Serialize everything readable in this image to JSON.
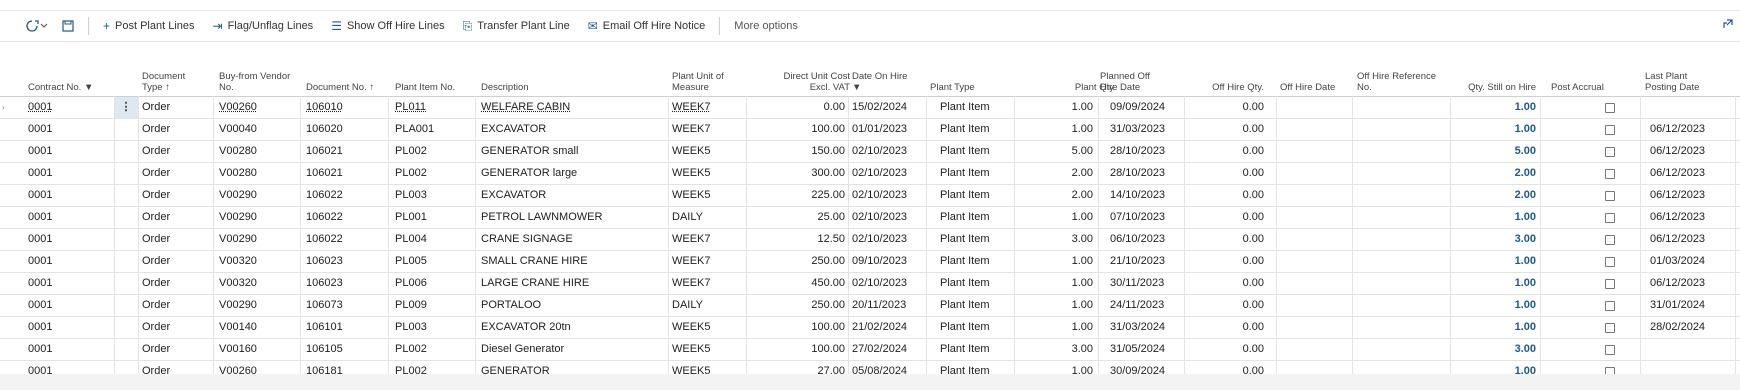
{
  "toolbar": {
    "icon_left_1": "refresh-options-icon",
    "icon_left_2": "save-icon",
    "buttons": [
      {
        "name": "post-plant-lines-button",
        "icon": "plus-icon",
        "glyph": "+",
        "label": "Post Plant Lines"
      },
      {
        "name": "flag-unflag-lines-button",
        "icon": "flag-icon",
        "glyph": "⇥",
        "label": "Flag/Unflag Lines"
      },
      {
        "name": "show-off-hire-lines-button",
        "icon": "list-icon",
        "glyph": "☰",
        "label": "Show Off Hire Lines"
      },
      {
        "name": "transfer-plant-line-button",
        "icon": "transfer-icon",
        "glyph": "⎘",
        "label": "Transfer Plant Line"
      },
      {
        "name": "email-off-hire-notice-button",
        "icon": "email-icon",
        "glyph": "✉",
        "label": "Email Off Hire Notice"
      }
    ],
    "more_options": "More options"
  },
  "headers": {
    "contract_no": "Contract No.",
    "document_type_1": "Document",
    "document_type_2": "Type ↑",
    "vendor_no_1": "Buy-from Vendor",
    "vendor_no_2": "No.",
    "document_no": "Document No. ↑",
    "plant_item_no": "Plant Item No.",
    "description": "Description",
    "uom_1": "Plant Unit of",
    "uom_2": "Measure",
    "unit_cost_1": "Direct Unit Cost",
    "unit_cost_2": "Excl. VAT",
    "date_on_hire": "Date On Hire",
    "plant_type": "Plant Type",
    "plant_qty": "Plant Qty",
    "planned_off_1": "Planned Off",
    "planned_off_2": "Hire Date",
    "off_hire_qty": "Off Hire Qty.",
    "off_hire_date": "Off Hire Date",
    "off_hire_ref_1": "Off Hire Reference",
    "off_hire_ref_2": "No.",
    "qty_still_on_hire": "Qty. Still on Hire",
    "post_accrual": "Post Accrual",
    "last_posting_1": "Last Plant",
    "last_posting_2": "Posting Date"
  },
  "rows": [
    {
      "contract": "0001",
      "type": "Order",
      "vendor": "V00260",
      "doc": "106010",
      "item": "PL011",
      "desc": "WELFARE CABIN",
      "uom": "WEEK7",
      "cost": "0.00",
      "on_hire": "15/02/2024",
      "ptype": "Plant Item",
      "qty": "1.00",
      "planned_off": "09/09/2024",
      "off_qty": "0.00",
      "still": "1.00",
      "last_post": ""
    },
    {
      "contract": "0001",
      "type": "Order",
      "vendor": "V00040",
      "doc": "106020",
      "item": "PLA001",
      "desc": "EXCAVATOR",
      "uom": "WEEK7",
      "cost": "100.00",
      "on_hire": "01/01/2023",
      "ptype": "Plant Item",
      "qty": "1.00",
      "planned_off": "31/03/2023",
      "off_qty": "0.00",
      "still": "1.00",
      "last_post": "06/12/2023"
    },
    {
      "contract": "0001",
      "type": "Order",
      "vendor": "V00280",
      "doc": "106021",
      "item": "PL002",
      "desc": "GENERATOR small",
      "uom": "WEEK5",
      "cost": "150.00",
      "on_hire": "02/10/2023",
      "ptype": "Plant Item",
      "qty": "5.00",
      "planned_off": "28/10/2023",
      "off_qty": "0.00",
      "still": "5.00",
      "last_post": "06/12/2023"
    },
    {
      "contract": "0001",
      "type": "Order",
      "vendor": "V00280",
      "doc": "106021",
      "item": "PL002",
      "desc": "GENERATOR large",
      "uom": "WEEK5",
      "cost": "300.00",
      "on_hire": "02/10/2023",
      "ptype": "Plant Item",
      "qty": "2.00",
      "planned_off": "28/10/2023",
      "off_qty": "0.00",
      "still": "2.00",
      "last_post": "06/12/2023"
    },
    {
      "contract": "0001",
      "type": "Order",
      "vendor": "V00290",
      "doc": "106022",
      "item": "PL003",
      "desc": "EXCAVATOR",
      "uom": "WEEK5",
      "cost": "225.00",
      "on_hire": "02/10/2023",
      "ptype": "Plant Item",
      "qty": "2.00",
      "planned_off": "14/10/2023",
      "off_qty": "0.00",
      "still": "2.00",
      "last_post": "06/12/2023"
    },
    {
      "contract": "0001",
      "type": "Order",
      "vendor": "V00290",
      "doc": "106022",
      "item": "PL001",
      "desc": "PETROL LAWNMOWER",
      "uom": "DAILY",
      "cost": "25.00",
      "on_hire": "02/10/2023",
      "ptype": "Plant Item",
      "qty": "1.00",
      "planned_off": "07/10/2023",
      "off_qty": "0.00",
      "still": "1.00",
      "last_post": "06/12/2023"
    },
    {
      "contract": "0001",
      "type": "Order",
      "vendor": "V00290",
      "doc": "106022",
      "item": "PL004",
      "desc": "CRANE SIGNAGE",
      "uom": "WEEK7",
      "cost": "12.50",
      "on_hire": "02/10/2023",
      "ptype": "Plant Item",
      "qty": "3.00",
      "planned_off": "06/10/2023",
      "off_qty": "0.00",
      "still": "3.00",
      "last_post": "06/12/2023"
    },
    {
      "contract": "0001",
      "type": "Order",
      "vendor": "V00320",
      "doc": "106023",
      "item": "PL005",
      "desc": "SMALL CRANE HIRE",
      "uom": "WEEK7",
      "cost": "250.00",
      "on_hire": "09/10/2023",
      "ptype": "Plant Item",
      "qty": "1.00",
      "planned_off": "21/10/2023",
      "off_qty": "0.00",
      "still": "1.00",
      "last_post": "01/03/2024"
    },
    {
      "contract": "0001",
      "type": "Order",
      "vendor": "V00320",
      "doc": "106023",
      "item": "PL006",
      "desc": "LARGE CRANE HIRE",
      "uom": "WEEK7",
      "cost": "450.00",
      "on_hire": "02/10/2023",
      "ptype": "Plant Item",
      "qty": "1.00",
      "planned_off": "30/11/2023",
      "off_qty": "0.00",
      "still": "1.00",
      "last_post": "06/12/2023"
    },
    {
      "contract": "0001",
      "type": "Order",
      "vendor": "V00290",
      "doc": "106073",
      "item": "PL009",
      "desc": "PORTALOO",
      "uom": "DAILY",
      "cost": "250.00",
      "on_hire": "20/11/2023",
      "ptype": "Plant Item",
      "qty": "1.00",
      "planned_off": "24/11/2023",
      "off_qty": "0.00",
      "still": "1.00",
      "last_post": "31/01/2024"
    },
    {
      "contract": "0001",
      "type": "Order",
      "vendor": "V00140",
      "doc": "106101",
      "item": "PL003",
      "desc": "EXCAVATOR 20tn",
      "uom": "WEEK5",
      "cost": "100.00",
      "on_hire": "21/02/2024",
      "ptype": "Plant Item",
      "qty": "1.00",
      "planned_off": "31/03/2024",
      "off_qty": "0.00",
      "still": "1.00",
      "last_post": "28/02/2024"
    },
    {
      "contract": "0001",
      "type": "Order",
      "vendor": "V00160",
      "doc": "106105",
      "item": "PL002",
      "desc": "Diesel Generator",
      "uom": "WEEK5",
      "cost": "100.00",
      "on_hire": "27/02/2024",
      "ptype": "Plant Item",
      "qty": "3.00",
      "planned_off": "31/05/2024",
      "off_qty": "0.00",
      "still": "3.00",
      "last_post": ""
    },
    {
      "contract": "0001",
      "type": "Order",
      "vendor": "V00260",
      "doc": "106181",
      "item": "PL002",
      "desc": "GENERATOR",
      "uom": "WEEK5",
      "cost": "27.00",
      "on_hire": "05/08/2024",
      "ptype": "Plant Item",
      "qty": "1.00",
      "planned_off": "30/09/2024",
      "off_qty": "0.00",
      "still": "1.00",
      "last_post": ""
    }
  ],
  "colors": {
    "accent": "#1a5c8e",
    "selected_cell": "#dfe8f1"
  }
}
